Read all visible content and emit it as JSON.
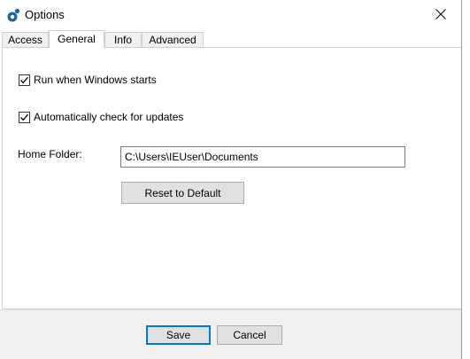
{
  "window": {
    "title": "Options"
  },
  "tabs": [
    {
      "label": "Access",
      "active": false
    },
    {
      "label": "General",
      "active": true
    },
    {
      "label": "Info",
      "active": false
    },
    {
      "label": "Advanced",
      "active": false
    }
  ],
  "general": {
    "run_on_startup": {
      "label": "Run when Windows starts",
      "checked": true
    },
    "auto_update": {
      "label": "Automatically check for updates",
      "checked": true
    },
    "home_folder": {
      "label": "Home Folder:",
      "value": "C:\\Users\\IEUser\\Documents"
    },
    "reset_label": "Reset to Default"
  },
  "footer": {
    "save_label": "Save",
    "cancel_label": "Cancel"
  },
  "colors": {
    "accent": "#0078d7",
    "footer_bg": "#f0f0f0",
    "button_bg": "#e1e1e1",
    "icon_blue": "#1f5fa8"
  },
  "icons": {
    "app": "app-logo-icon",
    "close": "close-icon",
    "check": "checkmark-icon"
  }
}
